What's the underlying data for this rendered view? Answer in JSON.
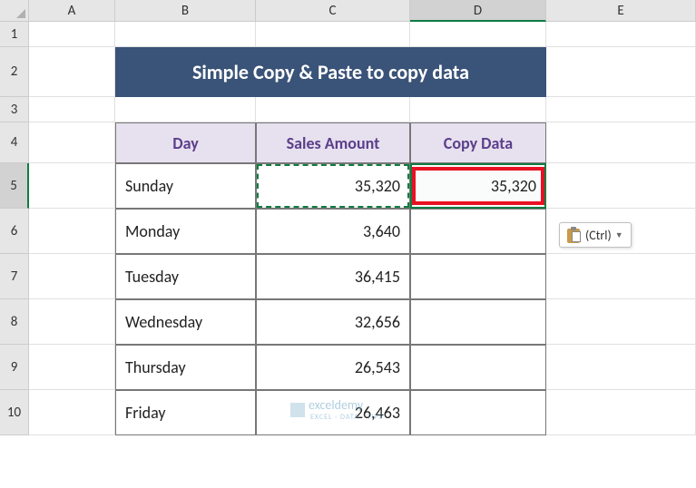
{
  "columns": [
    "A",
    "B",
    "C",
    "D",
    "E"
  ],
  "rows": [
    "1",
    "2",
    "3",
    "4",
    "5",
    "6",
    "7",
    "8",
    "9",
    "10"
  ],
  "title": "Simple Copy & Paste to copy data",
  "table": {
    "headers": {
      "day": "Day",
      "sales": "Sales Amount",
      "copy": "Copy Data"
    },
    "rows": [
      {
        "day": "Sunday",
        "sales": "35,320",
        "copy": "35,320"
      },
      {
        "day": "Monday",
        "sales": "3,640",
        "copy": ""
      },
      {
        "day": "Tuesday",
        "sales": "36,415",
        "copy": ""
      },
      {
        "day": "Wednesday",
        "sales": "32,656",
        "copy": ""
      },
      {
        "day": "Thursday",
        "sales": "26,543",
        "copy": ""
      },
      {
        "day": "Friday",
        "sales": "26,463",
        "copy": ""
      }
    ]
  },
  "pasteOptions": {
    "label": "(Ctrl)"
  },
  "watermark": {
    "name": "exceldemy",
    "tagline": "EXCEL · DATA · TIPS"
  },
  "activeColumn": "D",
  "activeRow": "5"
}
